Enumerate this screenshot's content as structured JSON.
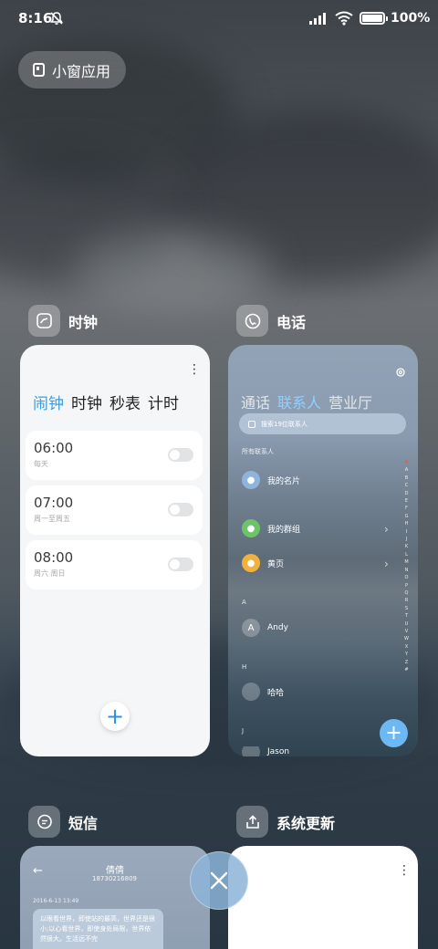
{
  "status_bar": {
    "time": "8:16",
    "mute_icon": "bell-off-icon",
    "battery": "100%"
  },
  "float_pill": {
    "label": "小窗应用",
    "icon": "small-window-icon"
  },
  "apps": {
    "clock": {
      "name": "时钟",
      "tabs": [
        "闹钟",
        "时钟",
        "秒表",
        "计时"
      ],
      "alarms": [
        {
          "time": "06:00",
          "repeat": "每天"
        },
        {
          "time": "07:00",
          "repeat": "周一至周五"
        },
        {
          "time": "08:00",
          "repeat": "周六 周日"
        }
      ],
      "add_label": "+"
    },
    "phone": {
      "name": "电话",
      "tabs": [
        "通话",
        "联系人",
        "营业厅"
      ],
      "search_placeholder": "搜索19位联系人",
      "section_all": "所有联系人",
      "items": {
        "my_card": "我的名片",
        "my_groups": "我的群组",
        "yellow_pages": "黄页"
      },
      "section_a": "A",
      "contact_andy": "Andy",
      "contact_andy_initial": "A",
      "section_h": "H",
      "contact_haha": "哈哈",
      "section_j": "J",
      "contact_jason": "Jason",
      "alphabet": [
        "#",
        "A",
        "B",
        "C",
        "D",
        "E",
        "F",
        "G",
        "H",
        "I",
        "J",
        "K",
        "L",
        "M",
        "N",
        "O",
        "P",
        "Q",
        "R",
        "S",
        "T",
        "U",
        "V",
        "W",
        "X",
        "Y",
        "Z",
        "#"
      ],
      "add_label": "+"
    },
    "sms": {
      "name": "短信",
      "contact": "倩倩",
      "number": "18730216809",
      "date": "2016-6-13 13:49",
      "message": "以眼看世界，即使站的最高，世界还是很小;以心看世界，即使身处局限，世界依然很大。生活远不完"
    },
    "update": {
      "name": "系统更新"
    }
  },
  "colors": {
    "accent": "#3a9ce6",
    "contacts_accent": "#8fd0ff"
  }
}
